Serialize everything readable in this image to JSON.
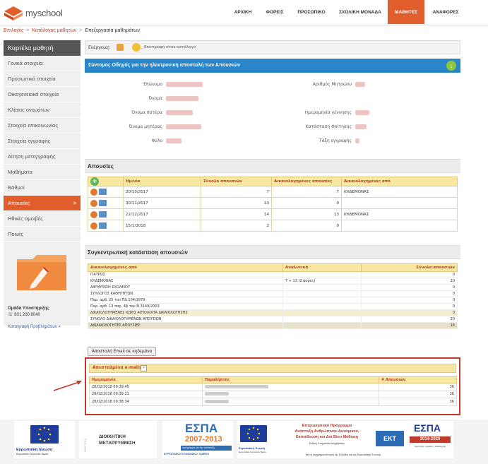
{
  "app": {
    "logo_text": "myschool"
  },
  "nav": {
    "items": [
      "ΑΡΧΙΚΗ",
      "ΦΟΡΕΙΣ",
      "ΠΡΟΣΩΠΙΚΟ",
      "ΣΧΟΛΙΚΗ ΜΟΝΑΔΑ",
      "ΜΑΘΗΤΕΣ",
      "ΑΝΑΦΟΡΕΣ"
    ],
    "active": "ΜΑΘΗΤΕΣ"
  },
  "breadcrumb": {
    "items": [
      "Επιλογές",
      "Κατάλογος μαθητών",
      "Επεξεργασία μαθημάτων"
    ],
    "separator": ">"
  },
  "sidebar": {
    "title": "Καρτέλα μαθητή",
    "items": [
      "Γενικά στοιχεία",
      "Προσωπικά στοιχεία",
      "Οικογενειακά στοιχεία",
      "Κλίσεις ονομάτων",
      "Στοιχεία επικοινωνίας",
      "Στοιχεία εγγραφής",
      "Αίτηση μετεγγραφής",
      "Μαθήματα",
      "Βαθμοί",
      "Απουσίες",
      "Ηθικές αμοιβές",
      "Ποινές"
    ],
    "active": "Απουσίες",
    "active_chevron": ">",
    "support_title": "Ομάδα Υποστήριξης",
    "support_phone": "☏ 801 200 8040",
    "report_link": "Καταγραφή Προβλημάτων »"
  },
  "actions": {
    "label": "Ενέργειες:",
    "back_label": "Επιστροφή στον κατάλογο"
  },
  "guide_bar": {
    "text": "Σύντομος Οδηγός για την ηλεκτρονική αποστολή των Απουσιών",
    "icon": "download-icon"
  },
  "student": {
    "left_labels": [
      "Επώνυμο",
      "Όνομα",
      "Όνομα πατέρα",
      "Όνομα μητέρας",
      "Φύλο"
    ],
    "right_labels": [
      "Αριθμός Μητρώου",
      "Ημερομηνία γέννησης",
      "Κατάσταση Φοίτησης",
      "Τάξη εγγραφής"
    ]
  },
  "absences": {
    "title": "Απουσίες",
    "columns": [
      "Ημ/νία",
      "Σύνολο απουσιών",
      "Δικαιολογημένες απουσίες",
      "Δικαιολογημένες από"
    ],
    "rows": [
      {
        "date": "20/10/2017",
        "total": "7",
        "justified": "7",
        "by": "ΚΗΔΕΜΟΝΑΣ"
      },
      {
        "date": "30/11/2017",
        "total": "13",
        "justified": "0",
        "by": ""
      },
      {
        "date": "22/12/2017",
        "total": "14",
        "justified": "13",
        "by": "ΚΗΔΕΜΟΝΑΣ"
      },
      {
        "date": "15/1/2018",
        "total": "2",
        "justified": "0",
        "by": ""
      }
    ]
  },
  "summary": {
    "title": "Συγκεντρωτική κατάσταση απουσιών",
    "columns": [
      "Δικαιολογημένες από",
      "Αναλυτικά",
      "Σύνολο απουσιών"
    ],
    "rows": [
      {
        "label": "ΓΙΑΤΡΟΣ",
        "detail": "",
        "value": "0"
      },
      {
        "label": "ΚΗΔΕΜΟΝΑΣ",
        "detail": "7 + 13 (2 φορές)",
        "value": "20"
      },
      {
        "label": "ΔΙΕΥΘΥΝΣΗ ΣΧΟΛΕΙΟΥ",
        "detail": "",
        "value": "0"
      },
      {
        "label": "ΣΥΛΛΟΓΟΣ ΚΑΘΗΓΗΤΩΝ",
        "detail": "",
        "value": "0"
      },
      {
        "label": "Παρ. αρθ. 25 του ΠΔ 104/1979",
        "detail": "",
        "value": "0"
      },
      {
        "label": "Παρ. αρθ. 13 παρ. 4β του Ν 3149/2003",
        "detail": "",
        "value": "0"
      },
      {
        "label": "ΔΙΚΑΙΟΛΟΓΗΜΕΝΕΣ ΧΩΡΙΣ ΑΙΤΙΟΛΟΓΙΑ ΔΙΚΑΙΟΛΟΓΗΣΗΣ",
        "detail": "",
        "value": "0"
      },
      {
        "label": "ΣΥΝΟΛΟ ΔΙΚΑΙΟΛΟΓΗΜΕΝΩΝ ΑΠΟΥΣΙΩΝ",
        "detail": "",
        "value": "20"
      },
      {
        "label": "ΑΔΙΚΑΙΟΛΟΓΗΤΕΣ ΑΠΟΥΣΙΕΣ",
        "detail": "",
        "value": "16"
      }
    ]
  },
  "email_button": {
    "label": "Αποστολή Email σε κηδεμόνα"
  },
  "sent_emails": {
    "title": "Απεσταλμένα e-mails",
    "toggle": "-",
    "columns": [
      "Ημερομηνία",
      "Παραλήπτης",
      "# Απουσιών"
    ],
    "rows": [
      {
        "date": "28/02/2018 09:39:45",
        "count": "36"
      },
      {
        "date": "28/02/2018 09:39:21",
        "count": "36"
      },
      {
        "date": "28/02/2018 09:38:34",
        "count": "36"
      }
    ]
  },
  "footer": {
    "eu_label": "Ευρωπαϊκή Ένωση",
    "eu_sub": "Ευρωπαϊκό Κοινωνικό Ταμείο",
    "admin_reform": "ΔΙΟΙΚΗΤΙΚΗ ΜΕΤΑΡΡΥΘΜΙΣΗ",
    "admin_years": "2007-2013",
    "espa": "ΕΣΠΑ",
    "espa_years_1": "2007-2013",
    "espa_fund": "ΕΥΡΩΠΑΪΚΟ ΚΟΙΝΩΝΙΚΟ ΤΑΜΕΙΟ",
    "espa_slogan": "πρόγραμμα για την ανάπτυξη",
    "op_title": "Επιχειρησιακό Πρόγραμμα",
    "op_line2": "Ανάπτυξη Ανθρώπινου Δυναμικού,",
    "op_line3": "Εκπαίδευση και Διά Βίου Μάθηση",
    "op_line4": "Ειδική Υπηρεσία Διαχείρισης",
    "op_line5": "Με τη συγχρηματοδότηση της Ελλάδας και της Ευρωπαϊκής Ένωσης",
    "ekt": "ΕΚΤ",
    "espa_years_2": "2014-2020",
    "espa2_slogan": "ανάπτυξη - εργασία - αλληλεγγύη"
  },
  "colors": {
    "accent": "#e25d2c",
    "blue": "#2a86c9",
    "header_yellow": "#f7e7a1",
    "link_red": "#c0392b"
  }
}
